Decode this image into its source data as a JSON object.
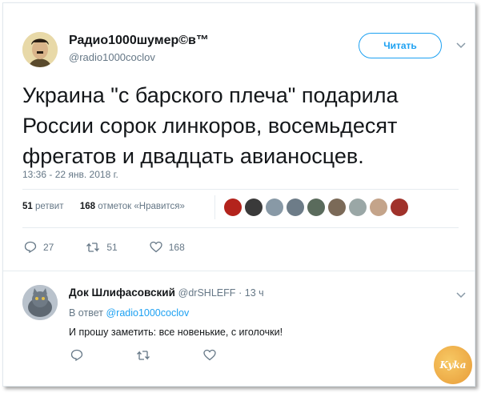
{
  "tweet": {
    "author_name": "Радио1000шумер©в™",
    "author_handle": "@radio1000coclov",
    "follow_label": "Читать",
    "text": "Украина \"с барского плеча\" подарила России сорок линкоров, восемьдесят фрегатов и двадцать авианосцев.",
    "timestamp": "13:36 - 22 янв. 2018 г.",
    "retweets_count": "51",
    "retweets_label": "ретвит",
    "likes_count": "168",
    "likes_label": "отметок «Нравится»",
    "action_reply_count": "27",
    "action_retweet_count": "51",
    "action_like_count": "168"
  },
  "reply": {
    "author_name": "Док Шлифасовский",
    "author_handle": "@drSHLEFF",
    "time": "· 13 ч",
    "reply_to_label": "В ответ",
    "reply_to_handle": "@radio1000coclov",
    "text": "И прошу заметить: все новенькие, с иголочки!"
  },
  "watermark": "Kyka",
  "colors": {
    "accent": "#1da1f2",
    "muted": "#657786",
    "text": "#14171a",
    "border": "#e6ecf0"
  },
  "likers": [
    {
      "icon": "hammer-sickle-avatar",
      "color": "#b3231c"
    },
    {
      "icon": "dark-avatar",
      "color": "#3a3a3a"
    },
    {
      "icon": "default-avatar",
      "color": "#8899a6"
    },
    {
      "icon": "cat-avatar",
      "color": "#6d7c88"
    },
    {
      "icon": "pattern-avatar",
      "color": "#5a6b5c"
    },
    {
      "icon": "person-avatar",
      "color": "#7b6a58"
    },
    {
      "icon": "car-avatar",
      "color": "#9aa7a6"
    },
    {
      "icon": "face-avatar",
      "color": "#c4a48a"
    },
    {
      "icon": "red-avatar",
      "color": "#a0322b"
    }
  ]
}
